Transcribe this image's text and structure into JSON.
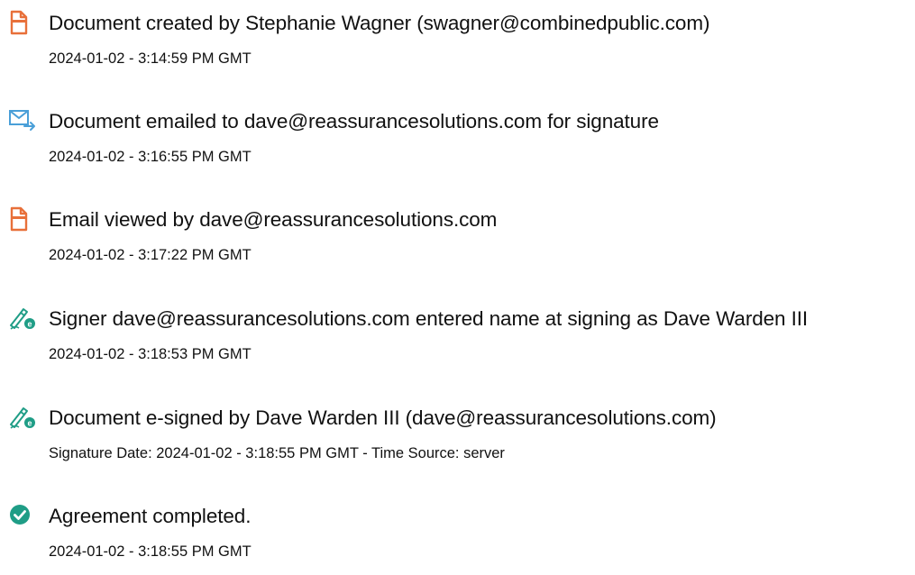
{
  "colors": {
    "doc_icon": "#e8703a",
    "mail_icon": "#4a9fd8",
    "sign_icon": "#1f9d86",
    "complete_icon": "#1f9d86"
  },
  "events": [
    {
      "icon": "document-icon",
      "title": "Document created by Stephanie Wagner (swagner@combinedpublic.com)",
      "meta": "2024-01-02 - 3:14:59 PM GMT"
    },
    {
      "icon": "email-icon",
      "title": "Document emailed to dave@reassurancesolutions.com for signature",
      "meta": "2024-01-02 - 3:16:55 PM GMT"
    },
    {
      "icon": "document-icon",
      "title": "Email viewed by dave@reassurancesolutions.com",
      "meta": "2024-01-02 - 3:17:22 PM GMT"
    },
    {
      "icon": "signature-pen-icon",
      "title": "Signer dave@reassurancesolutions.com entered name at signing as Dave Warden III",
      "meta": "2024-01-02 - 3:18:53 PM GMT"
    },
    {
      "icon": "signature-pen-icon",
      "title": "Document e-signed by Dave Warden III (dave@reassurancesolutions.com)",
      "meta": "Signature Date: 2024-01-02 - 3:18:55 PM GMT - Time Source: server"
    },
    {
      "icon": "checkmark-circle-icon",
      "title": "Agreement completed.",
      "meta": "2024-01-02 - 3:18:55 PM GMT"
    }
  ]
}
